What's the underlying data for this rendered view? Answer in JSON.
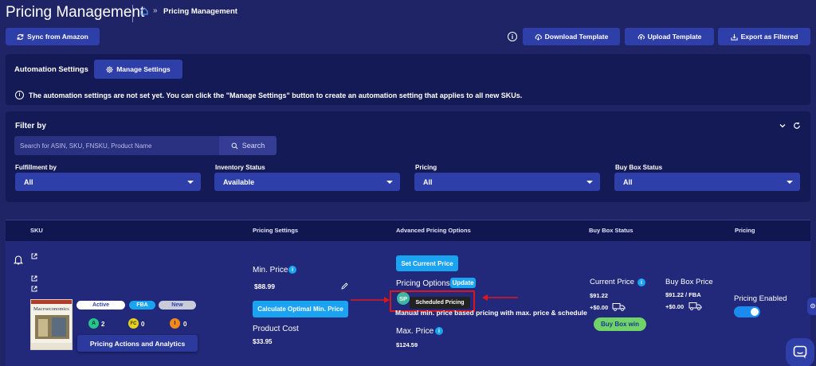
{
  "header": {
    "title": "Pricing Management",
    "breadcrumb_separator": "»",
    "breadcrumb_current": "Pricing Management"
  },
  "toolbar": {
    "sync_label": "Sync from Amazon",
    "info_glyph": "i",
    "download_label": "Download Template",
    "upload_label": "Upload Template",
    "export_label": "Export as Filtered"
  },
  "automation": {
    "label": "Automation Settings",
    "manage_label": "Manage Settings",
    "notice": "The automation settings are not set yet. You can click the \"Manage Settings\" button to create an automation setting that applies to all new SKUs."
  },
  "filter": {
    "title": "Filter by",
    "search_placeholder": "Search for ASIN, SKU, FNSKU, Product Name",
    "search_label": "Search",
    "fields": [
      {
        "label": "Fulfillment by",
        "value": "All"
      },
      {
        "label": "Inventory Status",
        "value": "Available"
      },
      {
        "label": "Pricing",
        "value": "All"
      },
      {
        "label": "Buy Box Status",
        "value": "All"
      }
    ]
  },
  "table": {
    "headers": {
      "sku": "SKU",
      "pricing_settings": "Pricing Settings",
      "advanced": "Advanced Pricing Options",
      "buybox": "Buy Box Status",
      "pricing": "Pricing"
    },
    "row": {
      "product_title": "Macroeconomics",
      "tags": {
        "active": "Active",
        "fba": "FBA",
        "condition": "New"
      },
      "badges": [
        {
          "letter": "A",
          "count": "2",
          "color": "#27c58a"
        },
        {
          "letter": "FC",
          "count": "0",
          "color": "#e7d21c"
        },
        {
          "letter": "I",
          "count": "0",
          "color": "#f08a1d"
        }
      ],
      "actions_label": "Pricing Actions and Analytics",
      "min_price_label": "Min. Price",
      "min_price_value": "$88.99",
      "calc_label": "Calculate Optimal Min. Price",
      "product_cost_label": "Product Cost",
      "product_cost_value": "$33.95",
      "set_current_label": "Set Current Price",
      "pricing_options_label": "Pricing Options",
      "update_label": "Update",
      "sp_badge": "SP",
      "tooltip": "Scheduled Pricing",
      "strategy_text": "Manual min. price based pricing with max. price & schedule",
      "max_price_label": "Max. Price",
      "max_price_value": "$124.59",
      "current_price_label": "Current Price",
      "current_price_value": "$91.22",
      "current_shipping": "+$0.00",
      "buy_box_price_label": "Buy Box Price",
      "buy_box_price_value": "$91.22 / FBA",
      "buy_box_shipping": "+$0.00",
      "buy_box_win_label": "Buy Box win",
      "pricing_enabled_label": "Pricing Enabled",
      "pricing_enabled": true
    }
  },
  "colors": {
    "background": "#1f2467",
    "panel": "#141a55",
    "accent": "#1aa3f0",
    "button": "#2f3faa",
    "buy_box_win": "#6fd36a",
    "highlight": "#e0151b"
  }
}
